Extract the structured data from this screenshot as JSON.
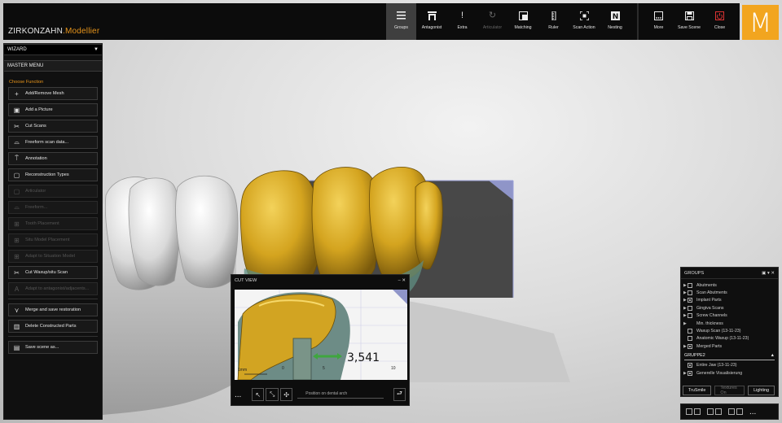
{
  "app": {
    "brand_main": "ZIRKONZAHN",
    "brand_sub": ".Modellier",
    "logo_letter": "M"
  },
  "toolbar": {
    "tools": [
      {
        "label": "Groups",
        "icon": "menu-icon",
        "active": true
      },
      {
        "label": "Antagonist",
        "icon": "antagonist-icon"
      },
      {
        "label": "Extra",
        "icon": "exclamation-icon"
      },
      {
        "label": "Articulator",
        "icon": "articulator-icon",
        "disabled": true
      },
      {
        "label": "Matching",
        "icon": "matching-icon"
      },
      {
        "label": "Ruler",
        "icon": "ruler-icon"
      },
      {
        "label": "Scan Action",
        "icon": "scan-action-icon"
      },
      {
        "label": "Nesting",
        "icon": "nesting-icon"
      }
    ],
    "right": [
      {
        "label": "More",
        "icon": "more-icon"
      },
      {
        "label": "Save Scene",
        "icon": "save-icon"
      },
      {
        "label": "Close",
        "icon": "close-power-icon"
      }
    ]
  },
  "left_panel": {
    "wizard_label": "WIZARD",
    "master_menu": "MASTER MENU",
    "choose_function": "Choose Function",
    "buttons": [
      {
        "label": "Add/Remove Mesh",
        "icon": "plus-icon",
        "enabled": true
      },
      {
        "label": "Add a Picture",
        "icon": "picture-icon",
        "enabled": true
      },
      {
        "label": "Cut Scans",
        "icon": "scissors-icon",
        "enabled": true
      },
      {
        "label": "Freeform scan data...",
        "icon": "freeform-icon",
        "enabled": true
      },
      {
        "label": "Annotation",
        "icon": "pin-icon",
        "enabled": true
      },
      {
        "label": "Reconstruction Types",
        "icon": "reconstruction-icon",
        "enabled": true
      },
      {
        "label": "Articulator",
        "icon": "articulator-icon",
        "enabled": false
      },
      {
        "label": "Freeform...",
        "icon": "freeform-icon",
        "enabled": false
      },
      {
        "label": "Tooth Placement",
        "icon": "tooth-icon",
        "enabled": false
      },
      {
        "label": "Situ Model Placement",
        "icon": "situ-icon",
        "enabled": false
      },
      {
        "label": "Adapt to Situation Model",
        "icon": "adapt-icon",
        "enabled": false
      },
      {
        "label": "Cut Waxup/situ Scan",
        "icon": "scissors-icon",
        "enabled": true
      },
      {
        "label": "Adapt to antagonist/adjacents...",
        "icon": "adapt-a-icon",
        "enabled": false
      }
    ],
    "buttons2": [
      {
        "label": "Merge and save restoration",
        "icon": "merge-icon"
      },
      {
        "label": "Delete Constructed Parts",
        "icon": "trash-icon"
      }
    ],
    "buttons3": [
      {
        "label": "Save scene as...",
        "icon": "save-icon"
      }
    ]
  },
  "cut_view": {
    "title": "CUT VIEW",
    "measurement": "3,541",
    "scale_unit": "1mm",
    "tick_labels": [
      "0",
      "5",
      "10"
    ],
    "position_label": "Position on dental arch",
    "more": "..."
  },
  "groups": {
    "title": "GROUPS",
    "items": [
      {
        "label": "Abutments",
        "checked": false
      },
      {
        "label": "Scan Abutments",
        "checked": false
      },
      {
        "label": "Implant Parts",
        "checked": true
      },
      {
        "label": "Gingiva Scans",
        "checked": false
      },
      {
        "label": "Screw Channels",
        "checked": false
      },
      {
        "label": "Min. thickness",
        "checked": false,
        "no_box": true
      },
      {
        "label": "Waxup Scan (13-11-23)",
        "checked": false,
        "no_arrow": true
      },
      {
        "label": "Anatomic Waxup (13-11-23)",
        "checked": false,
        "no_arrow": true
      },
      {
        "label": "Merged Parts",
        "checked": true
      }
    ],
    "sub_title": "GRUPPE2",
    "sub_items": [
      {
        "label": "Entire Jaw (13-11-23)",
        "checked": true,
        "no_arrow": true
      },
      {
        "label": "Generelle Visualisierung",
        "checked": true
      }
    ],
    "buttons": [
      {
        "label": "TruSmile",
        "dim": false
      },
      {
        "label": "Textures On",
        "dim": true
      },
      {
        "label": "Lighting",
        "dim": false
      }
    ],
    "more": "..."
  }
}
